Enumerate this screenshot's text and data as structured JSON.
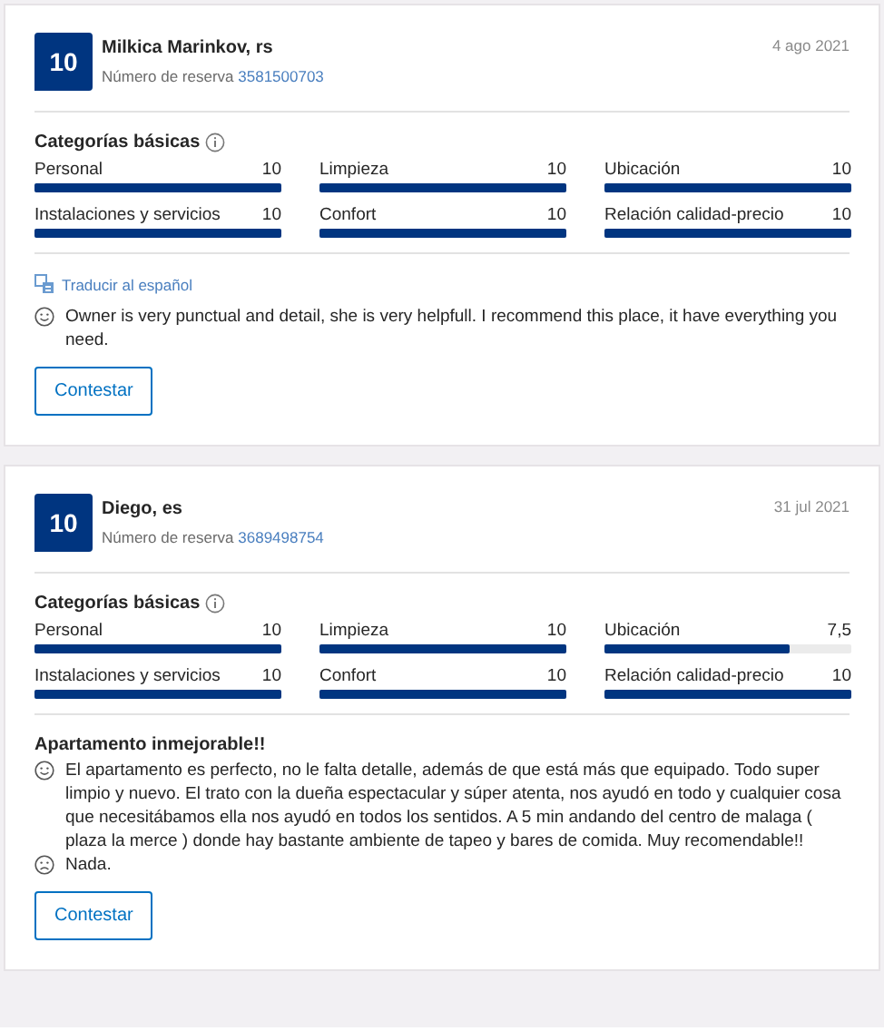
{
  "reviews": [
    {
      "score": "10",
      "name": "Milkica Marinkov, rs",
      "reservation_label": "Número de reserva",
      "reservation_number": "3581500703",
      "date": "4 ago 2021",
      "categories_title": "Categorías básicas",
      "categories": [
        {
          "name": "Personal",
          "score": "10",
          "level": 1
        },
        {
          "name": "Limpieza",
          "score": "10",
          "level": 1
        },
        {
          "name": "Ubicación",
          "score": "10",
          "level": 1
        },
        {
          "name": "Instalaciones y servicios",
          "score": "10",
          "level": 1
        },
        {
          "name": "Confort",
          "score": "10",
          "level": 1
        },
        {
          "name": "Relación calidad-precio",
          "score": "10",
          "level": 1
        }
      ],
      "translate_link": "Traducir al español",
      "comments": [
        {
          "kind": "positive",
          "text": "Owner is very punctual and detail, she is very helpfull. I recommend this place, it have everything you need."
        }
      ],
      "button": "Contestar"
    },
    {
      "score": "10",
      "name": "Diego, es",
      "reservation_label": "Número de reserva",
      "reservation_number": "3689498754",
      "date": "31 jul 2021",
      "categories_title": "Categorías básicas",
      "categories": [
        {
          "name": "Personal",
          "score": "10",
          "level": 1
        },
        {
          "name": "Limpieza",
          "score": "10",
          "level": 1
        },
        {
          "name": "Ubicación",
          "score": "7,5",
          "level": 0.75
        },
        {
          "name": "Instalaciones y servicios",
          "score": "10",
          "level": 1
        },
        {
          "name": "Confort",
          "score": "10",
          "level": 1
        },
        {
          "name": "Relación calidad-precio",
          "score": "10",
          "level": 1
        }
      ],
      "title": "Apartamento inmejorable!!",
      "comments": [
        {
          "kind": "positive",
          "text": "El apartamento es perfecto, no le falta detalle, además de que está más que equipado. Todo super limpio y nuevo. El trato con la dueña espectacular y súper atenta, nos ayudó en todo y cualquier cosa que necesitábamos ella nos ayudó en todos los sentidos. A 5 min andando del centro de malaga ( plaza la merce ) donde hay bastante ambiente de tapeo y bares de comida. Muy recomendable!!"
        },
        {
          "kind": "negative",
          "text": "Nada."
        }
      ],
      "button": "Contestar"
    }
  ]
}
